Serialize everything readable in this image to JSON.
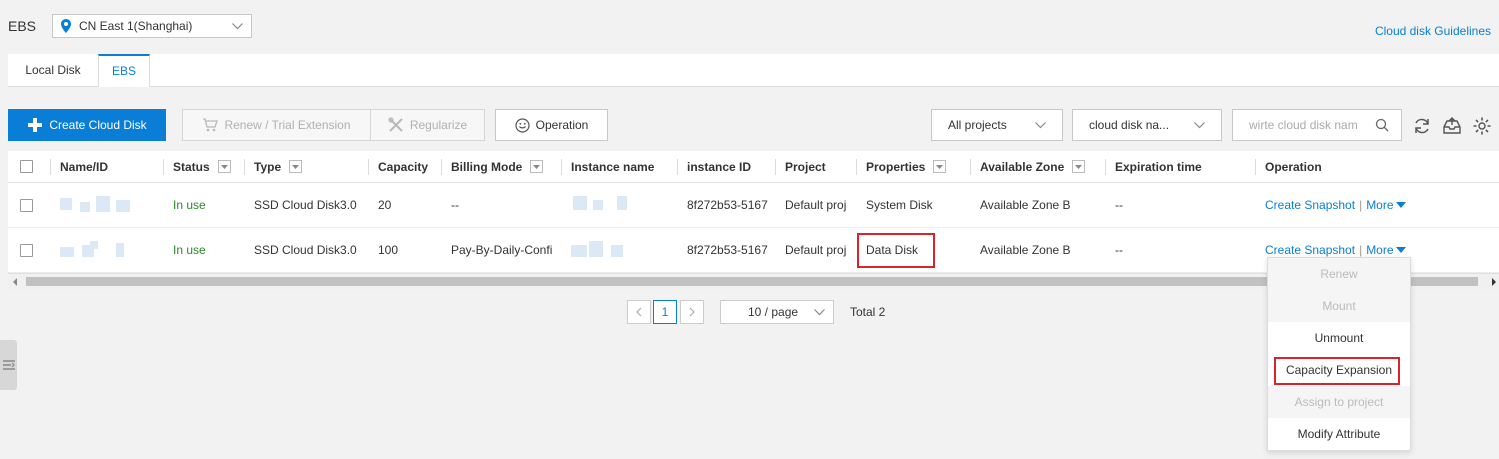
{
  "header": {
    "app_title": "EBS",
    "region": "CN East 1(Shanghai)",
    "guide_link": "Cloud disk Guidelines"
  },
  "tabs": [
    {
      "label": "Local Disk",
      "active": false
    },
    {
      "label": "EBS",
      "active": true
    }
  ],
  "toolbar": {
    "create_label": "Create Cloud Disk",
    "renew_label": "Renew / Trial Extension",
    "regularize_label": "Regularize",
    "operation_label": "Operation",
    "projects_select": "All projects",
    "name_select": "cloud disk na...",
    "search_placeholder": "wirte cloud disk nam"
  },
  "table": {
    "columns": [
      "Name/ID",
      "Status",
      "Type",
      "Capacity",
      "Billing Mode",
      "Instance name",
      "instance ID",
      "Project",
      "Properties",
      "Available Zone",
      "Expiration time",
      "Operation"
    ],
    "rows": [
      {
        "status": "In use",
        "type": "SSD Cloud Disk3.0",
        "capacity": "20",
        "billing": "--",
        "instance_id": "8f272b53-5167",
        "project": "Default proj",
        "properties": "System Disk",
        "zone": "Available Zone B",
        "expiration": "--",
        "op_snapshot": "Create Snapshot",
        "op_separator": "|",
        "op_more": "More"
      },
      {
        "status": "In use",
        "type": "SSD Cloud Disk3.0",
        "capacity": "100",
        "billing": "Pay-By-Daily-Confi",
        "instance_id": "8f272b53-5167",
        "project": "Default proj",
        "properties": "Data Disk",
        "zone": "Available Zone B",
        "expiration": "--",
        "op_snapshot": "Create Snapshot",
        "op_separator": "|",
        "op_more": "More"
      }
    ]
  },
  "pagination": {
    "current_page": "1",
    "page_size": "10 / page",
    "total": "Total 2"
  },
  "more_menu": [
    {
      "label": "Renew",
      "disabled": true
    },
    {
      "label": "Mount",
      "disabled": true
    },
    {
      "label": "Unmount",
      "disabled": false
    },
    {
      "label": "Capacity Expansion",
      "disabled": false
    },
    {
      "label": "Assign to project",
      "disabled": true
    },
    {
      "label": "Modify Attribute",
      "disabled": false
    }
  ],
  "colors": {
    "accent": "#0a7ed6",
    "status_ok": "#2a8a2a",
    "highlight_box": "#d9232d"
  }
}
